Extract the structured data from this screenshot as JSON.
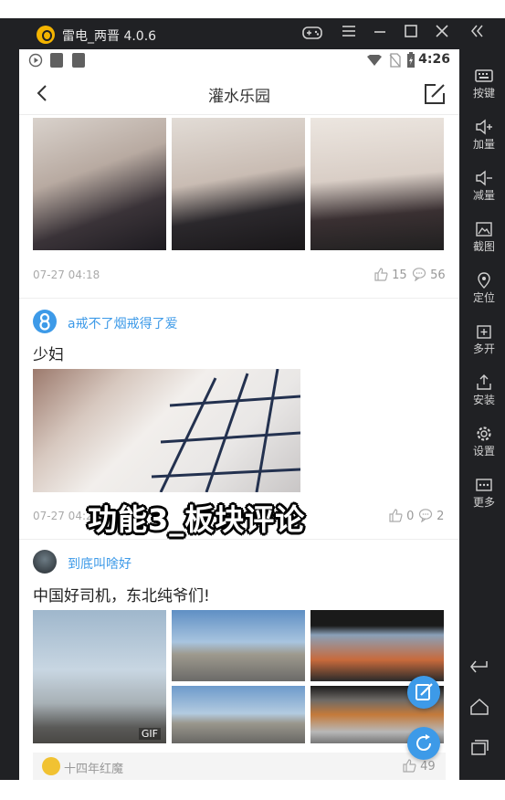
{
  "emulator": {
    "title": "雷电_两晋 4.0.6",
    "sidebar": [
      {
        "id": "keys",
        "label": "按键",
        "icon": "keyboard-icon"
      },
      {
        "id": "vol-up",
        "label": "加量",
        "icon": "volume-up-icon"
      },
      {
        "id": "vol-down",
        "label": "减量",
        "icon": "volume-down-icon"
      },
      {
        "id": "screenshot",
        "label": "截图",
        "icon": "screenshot-icon"
      },
      {
        "id": "location",
        "label": "定位",
        "icon": "location-icon"
      },
      {
        "id": "multi",
        "label": "多开",
        "icon": "multi-instance-icon"
      },
      {
        "id": "install",
        "label": "安装",
        "icon": "install-icon"
      },
      {
        "id": "settings",
        "label": "设置",
        "icon": "gear-icon"
      },
      {
        "id": "more",
        "label": "更多",
        "icon": "more-icon"
      }
    ]
  },
  "statusbar": {
    "time": "4:26"
  },
  "appbar": {
    "title": "灌水乐园"
  },
  "posts": [
    {
      "date": "07-27 04:18",
      "likes": "15",
      "comments": "56"
    },
    {
      "username": "a戒不了烟戒得了爱",
      "text": "少妇",
      "date": "07-27 04:20",
      "likes": "0",
      "comments": "2"
    },
    {
      "username": "到底叫啥好",
      "text": "中国好司机，东北纯爷们!",
      "gif_label": "GIF"
    }
  ],
  "comment_preview": {
    "username": "十四年红魔",
    "likes": "49"
  },
  "overlay_caption": "功能3_板块评论",
  "colors": {
    "accent": "#3d9ae8",
    "chrome": "#202124"
  }
}
